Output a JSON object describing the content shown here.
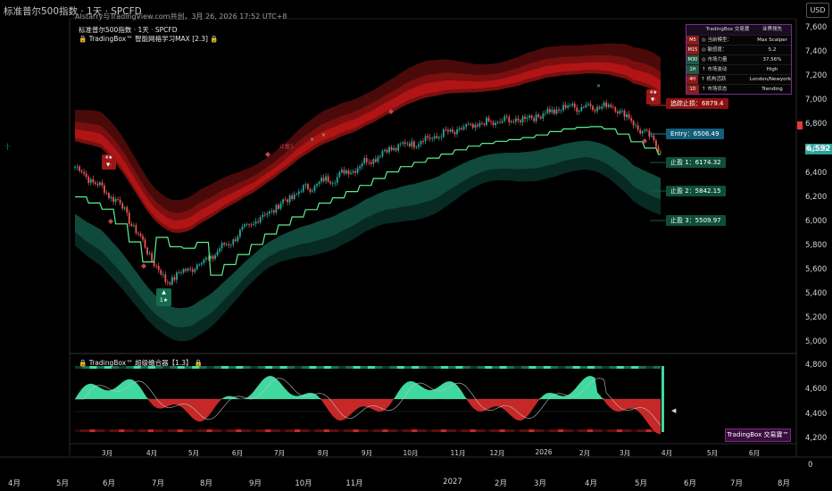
{
  "header": {
    "title": "标准普尔500指数 · 1天 · SPCFD",
    "watermark": "AIstarry与TradingView.com共创，3月 26, 2026 17:52 UTC+8",
    "currency": "USD"
  },
  "legend": {
    "line1": "标准普尔500指数 · 1天 · SPCFD",
    "line2": "TradingBox™ 智能网格学习MAX [2.3]",
    "sub_title": "TradingBox™ 超级蟾合器【1.3】"
  },
  "table": {
    "header": [
      "TradingBox 交易寶",
      "业界领先"
    ],
    "rows": [
      {
        "tf": "M5",
        "label": "◎ 当前模型：",
        "value": "Max Scalper",
        "color": "#8b1a1a"
      },
      {
        "tf": "M15",
        "label": "◎ 敏感度：",
        "value": "5.2",
        "color": "#8b1a1a"
      },
      {
        "tf": "M30",
        "label": "◎ 市场力量",
        "value": "37.56%",
        "color": "#1f5a44"
      },
      {
        "tf": "1H",
        "label": "↑ 市场波动",
        "value": "High",
        "color": "#1f5a44"
      },
      {
        "tf": "4H",
        "label": "↑ 机构活跃",
        "value": "London/Newyork",
        "color": "#8b1a1a"
      },
      {
        "tf": "1D",
        "label": "↑ 市场状态",
        "value": "Trending",
        "color": "#8b1a1a"
      }
    ]
  },
  "levels": {
    "trail_stop": "追踪止损：6879.4",
    "entry": "Entry：6506.49",
    "tp1": "止盈 1：6174.32",
    "tp2": "止盈 2：5842.15",
    "tp3": "止盈 3：5509.97",
    "tp1_marker": "止盈1"
  },
  "signals": {
    "sell_icon_text": "4★",
    "buy_icon_text": "1★"
  },
  "price_axis": {
    "ticks": [
      "7,600",
      "7,400",
      "7,200",
      "7,000",
      "6,800",
      "6,600",
      "6,400",
      "6,200",
      "6,000",
      "5,800",
      "5,600",
      "5,400",
      "5,200",
      "5,000"
    ],
    "current_price": "6,592",
    "current_color": "#26a69a"
  },
  "osc_axis": {
    "ticks": [
      "4,800",
      "4,600",
      "4,400",
      "4,200"
    ]
  },
  "x_axis": {
    "inner_ticks": [
      "3月",
      "4月",
      "5月",
      "6月",
      "7月",
      "8月",
      "9月",
      "10月",
      "11月",
      "12月",
      "2026",
      "2月",
      "3月",
      "4月",
      "5月",
      "6月"
    ],
    "outer_ticks": [
      "4月",
      "5月",
      "6月",
      "7月",
      "8月",
      "9月",
      "10月",
      "11月",
      "2027",
      "2月",
      "3月",
      "4月",
      "5月",
      "6月",
      "7月",
      "8月"
    ],
    "right_zero": "0"
  },
  "brand_label": "TradingBox 交易寶™",
  "colors": {
    "bull": "#26a69a",
    "bear": "#ef5350",
    "trail": "#5cf08a",
    "upper_band": "#b01414",
    "lower_band": "#0f4a3c"
  },
  "chart_data": {
    "type": "line",
    "title": "标准普尔500指数 · 1天 · SPCFD",
    "xlabel": "",
    "ylabel": "",
    "ylim": [
      5000,
      7600
    ],
    "x": [
      "2025-02",
      "2025-03",
      "2025-04",
      "2025-05",
      "2025-06",
      "2025-07",
      "2025-08",
      "2025-09",
      "2025-10",
      "2025-11",
      "2025-12",
      "2026-01",
      "2026-02",
      "2026-03"
    ],
    "series": [
      {
        "values": [
          6450,
          6150,
          5500,
          5700,
          6000,
          6250,
          6400,
          6600,
          6700,
          6800,
          6850,
          6950,
          6950,
          6600
        ]
      }
    ]
  }
}
